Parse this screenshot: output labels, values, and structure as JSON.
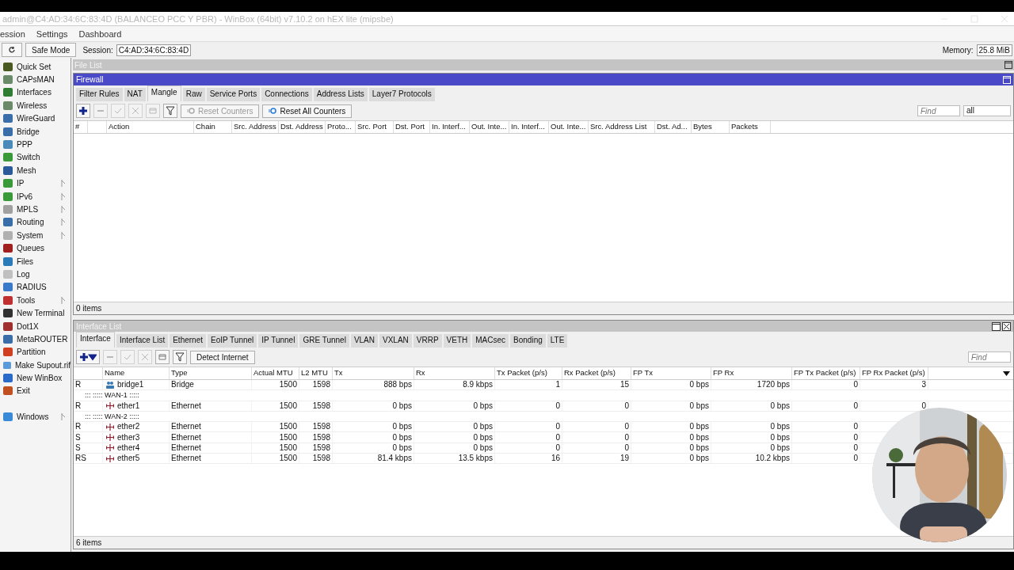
{
  "title_bar": {
    "title": "admin@C4:AD:34:6C:83:4D (BALANCEO PCC Y PBR) - WinBox (64bit) v7.10.2 on hEX lite (mipsbe)"
  },
  "menu": [
    "ession",
    "Settings",
    "Dashboard"
  ],
  "toolbar": {
    "safe_mode": "Safe Mode",
    "session_label": "Session:",
    "session": "C4:AD:34:6C:83:4D",
    "memory_label": "Memory:",
    "memory": "25.8 MiB"
  },
  "sidebar": [
    {
      "label": "Quick Set",
      "color": "#4a5a20",
      "submenu": false
    },
    {
      "label": "CAPsMAN",
      "color": "#6a8a6a",
      "submenu": false
    },
    {
      "label": "Interfaces",
      "color": "#2e7d32",
      "submenu": false
    },
    {
      "label": "Wireless",
      "color": "#6a8a6a",
      "submenu": false
    },
    {
      "label": "WireGuard",
      "color": "#3a6ea8",
      "submenu": false
    },
    {
      "label": "Bridge",
      "color": "#3a6ea8",
      "submenu": false
    },
    {
      "label": "PPP",
      "color": "#4a8ab8",
      "submenu": false
    },
    {
      "label": "Switch",
      "color": "#3a9a3a",
      "submenu": false
    },
    {
      "label": "Mesh",
      "color": "#2a5a9a",
      "submenu": false
    },
    {
      "label": "IP",
      "color": "#3a9a3a",
      "submenu": true
    },
    {
      "label": "IPv6",
      "color": "#3a9a3a",
      "submenu": true
    },
    {
      "label": "MPLS",
      "color": "#a0a0a0",
      "submenu": true
    },
    {
      "label": "Routing",
      "color": "#3a6ea8",
      "submenu": true
    },
    {
      "label": "System",
      "color": "#b0b0b0",
      "submenu": true
    },
    {
      "label": "Queues",
      "color": "#a02020",
      "submenu": false
    },
    {
      "label": "Files",
      "color": "#2a7ab8",
      "submenu": false
    },
    {
      "label": "Log",
      "color": "#c0c0c0",
      "submenu": false
    },
    {
      "label": "RADIUS",
      "color": "#3a7ac8",
      "submenu": false
    },
    {
      "label": "Tools",
      "color": "#c03030",
      "submenu": true
    },
    {
      "label": "New Terminal",
      "color": "#303030",
      "submenu": false
    },
    {
      "label": "Dot1X",
      "color": "#a03030",
      "submenu": false
    },
    {
      "label": "MetaROUTER",
      "color": "#3a6ea8",
      "submenu": false
    },
    {
      "label": "Partition",
      "color": "#d04020",
      "submenu": false
    },
    {
      "label": "Make Supout.rif",
      "color": "#5a9ad8",
      "submenu": false
    },
    {
      "label": "New WinBox",
      "color": "#2a6ac8",
      "submenu": false
    },
    {
      "label": "Exit",
      "color": "#c05020",
      "submenu": false
    },
    {
      "label": "Windows",
      "color": "#3a8ad8",
      "submenu": true
    }
  ],
  "file_list": {
    "title": "File List"
  },
  "firewall": {
    "title": "Firewall",
    "tabs": [
      {
        "label": "Filter Rules",
        "selected": false
      },
      {
        "label": "NAT",
        "selected": false
      },
      {
        "label": "Mangle",
        "selected": true
      },
      {
        "label": "Raw",
        "selected": false
      },
      {
        "label": "Service Ports",
        "selected": false
      },
      {
        "label": "Connections",
        "selected": false
      },
      {
        "label": "Address Lists",
        "selected": false
      },
      {
        "label": "Layer7 Protocols",
        "selected": false
      }
    ],
    "tools": [
      {
        "kind": "add",
        "disabled": false
      },
      {
        "kind": "remove",
        "disabled": true
      },
      {
        "kind": "enable",
        "disabled": true
      },
      {
        "kind": "disable",
        "disabled": true
      },
      {
        "kind": "comment",
        "disabled": true
      },
      {
        "kind": "filter",
        "disabled": false
      }
    ],
    "buttons": [
      {
        "label": "Reset Counters",
        "disabled": true
      },
      {
        "label": "Reset All Counters",
        "disabled": false
      }
    ],
    "find": {
      "placeholder": "Find"
    },
    "filter": {
      "value": "all"
    },
    "columns": [
      "#",
      "Action",
      "Chain",
      "Src. Address",
      "Dst. Address",
      "Proto...",
      "Src. Port",
      "Dst. Port",
      "In. Interf...",
      "Out. Inte...",
      "In. Interf...",
      "Out. Inte...",
      "Src. Address List",
      "Dst. Ad...",
      "Bytes",
      "Packets"
    ],
    "status": "0 items"
  },
  "interface_list": {
    "title": "Interface List",
    "tabs": [
      {
        "label": "Interface",
        "selected": true
      },
      {
        "label": "Interface List",
        "selected": false
      },
      {
        "label": "Ethernet",
        "selected": false
      },
      {
        "label": "EoIP Tunnel",
        "selected": false
      },
      {
        "label": "IP Tunnel",
        "selected": false
      },
      {
        "label": "GRE Tunnel",
        "selected": false
      },
      {
        "label": "VLAN",
        "selected": false
      },
      {
        "label": "VXLAN",
        "selected": false
      },
      {
        "label": "VRRP",
        "selected": false
      },
      {
        "label": "VETH",
        "selected": false
      },
      {
        "label": "MACsec",
        "selected": false
      },
      {
        "label": "Bonding",
        "selected": false
      },
      {
        "label": "LTE",
        "selected": false
      }
    ],
    "tools": [
      {
        "kind": "add",
        "disabled": false
      },
      {
        "kind": "remove",
        "disabled": true
      },
      {
        "kind": "enable",
        "disabled": true
      },
      {
        "kind": "disable",
        "disabled": true
      },
      {
        "kind": "comment",
        "disabled": false
      },
      {
        "kind": "filter",
        "disabled": false
      }
    ],
    "detect": "Detect Internet",
    "find": {
      "placeholder": "Find"
    },
    "columns": [
      "Name",
      "Type",
      "Actual MTU",
      "L2 MTU",
      "Tx",
      "Rx",
      "Tx Packet (p/s)",
      "Rx Packet (p/s)",
      "FP Tx",
      "FP Rx",
      "FP Tx Packet (p/s)",
      "FP Rx Packet (p/s)"
    ],
    "rows": [
      {
        "kind": "bridge",
        "flags": "R",
        "name": "bridge1",
        "cells": [
          "Bridge",
          "1500",
          "1598",
          "888 bps",
          "8.9 kbps",
          "1",
          "15",
          "0 bps",
          "1720 bps",
          "0",
          "3"
        ]
      },
      {
        "kind": "group",
        "label": "::: ::::: WAN-1 :::::"
      },
      {
        "kind": "ethernet",
        "flags": "R",
        "name": "ether1",
        "cells": [
          "Ethernet",
          "1500",
          "1598",
          "0 bps",
          "0 bps",
          "0",
          "0",
          "0 bps",
          "0 bps",
          "0",
          "0"
        ]
      },
      {
        "kind": "group",
        "label": "::: ::::: WAN-2 :::::"
      },
      {
        "kind": "ethernet",
        "flags": "R",
        "name": "ether2",
        "cells": [
          "Ethernet",
          "1500",
          "1598",
          "0 bps",
          "0 bps",
          "0",
          "0",
          "0 bps",
          "0 bps",
          "0"
        ]
      },
      {
        "kind": "ethernet",
        "flags": "S",
        "name": "ether3",
        "cells": [
          "Ethernet",
          "1500",
          "1598",
          "0 bps",
          "0 bps",
          "0",
          "0",
          "0 bps",
          "0 bps",
          "0"
        ]
      },
      {
        "kind": "ethernet",
        "flags": "S",
        "name": "ether4",
        "cells": [
          "Ethernet",
          "1500",
          "1598",
          "0 bps",
          "0 bps",
          "0",
          "0",
          "0 bps",
          "0 bps",
          "0"
        ]
      },
      {
        "kind": "ethernet",
        "flags": "RS",
        "name": "ether5",
        "cells": [
          "Ethernet",
          "1500",
          "1598",
          "81.4 kbps",
          "13.5 kbps",
          "16",
          "19",
          "0 bps",
          "10.2 kbps",
          "0"
        ]
      }
    ],
    "status": "6 items"
  }
}
